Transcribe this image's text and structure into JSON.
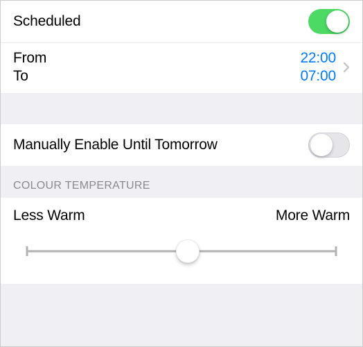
{
  "scheduled": {
    "label": "Scheduled",
    "enabled": true
  },
  "schedule": {
    "from_label": "From",
    "to_label": "To",
    "from_time": "22:00",
    "to_time": "07:00"
  },
  "manual": {
    "label": "Manually Enable Until Tomorrow",
    "enabled": false
  },
  "temperature": {
    "header": "COLOUR TEMPERATURE",
    "less_label": "Less Warm",
    "more_label": "More Warm",
    "value_percent": 52
  }
}
